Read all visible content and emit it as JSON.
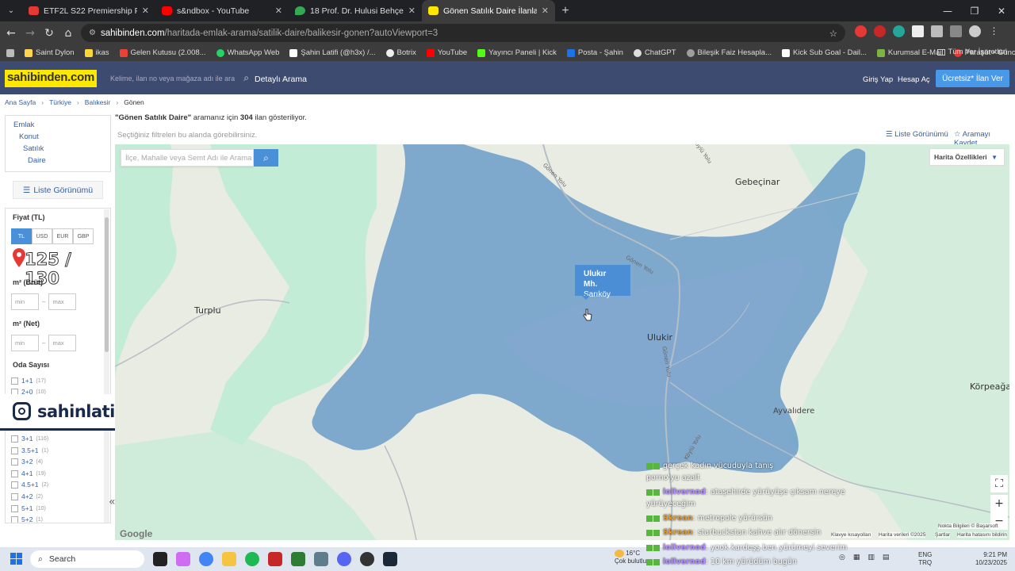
{
  "browser": {
    "tabs": [
      {
        "title": "ETF2L S22 Premiership Playoffs",
        "favcolor": "#e53935",
        "active": false
      },
      {
        "title": "s&ndbox - YouTube",
        "favcolor": "#ff0000",
        "active": false
      },
      {
        "title": "18 Prof. Dr. Hulusi Behçet Cd.",
        "favcolor": "#34a853",
        "active": false
      },
      {
        "title": "Gönen Satılık Daire İlanları ve S",
        "favcolor": "#ffe800",
        "active": true
      }
    ],
    "url_domain": "sahibinden.com",
    "url_path": "/haritada-emlak-arama/satilik-daire/balikesir-gonen?autoViewport=3",
    "bookmarks": [
      "Saint Dylon",
      "ikas",
      "Gelen Kutusu (2.008...",
      "WhatsApp Web",
      "Şahin Latifi (@h3x) /...",
      "Botrix",
      "YouTube",
      "Yayıncı Paneli | Kick",
      "Posta - Şahin",
      "ChatGPT",
      "Bileşik Faiz Hesapla...",
      "Kick Sub Goal - Dail...",
      "Kurumsal E-Mail",
      "Paraşüt • Güncel D..."
    ],
    "bookmark_all": "Tüm Yer İşaretleri"
  },
  "header": {
    "logo": "sahibinden.com",
    "search_placeholder": "Kelime, ilan no veya mağaza adı ile ara",
    "detailed_search": "Detaylı Arama",
    "login": "Giriş Yap",
    "register": "Hesap Aç",
    "post_ad": "Ücretsiz* İlan Ver"
  },
  "breadcrumb": [
    "Ana Sayfa",
    "Türkiye",
    "Balıkesir",
    "Gönen"
  ],
  "result": {
    "query": "\"Gönen Satılık Daire\"",
    "mid": " aramanız için ",
    "count": "304",
    "tail": " ilan gösteriliyor."
  },
  "hint": "Seçtiğiniz filtreleri bu alanda görebilirsiniz.",
  "list_view_link": "Liste Görünümü",
  "save_search": "Aramayı Kaydet",
  "category_nav": [
    "Emlak",
    "Konut",
    "Satılık",
    "Daire"
  ],
  "list_view_button": "Liste Görünümü",
  "filters": {
    "price_label": "Fiyat (TL)",
    "currencies": [
      "TL",
      "USD",
      "EUR",
      "GBP"
    ],
    "overlay_text": "125 / 130",
    "m2_gross_label": "m² (Brüt)",
    "m2_net_label": "m² (Net)",
    "min_placeholder": "min",
    "max_placeholder": "max",
    "rooms_label": "Oda Sayısı",
    "rooms": [
      {
        "label": "1+1",
        "count": "(17)"
      },
      {
        "label": "2+0",
        "count": "(10)"
      },
      {
        "label": "3+1",
        "count": "(116)"
      },
      {
        "label": "3.5+1",
        "count": "(1)"
      },
      {
        "label": "3+2",
        "count": "(4)"
      },
      {
        "label": "4+1",
        "count": "(19)"
      },
      {
        "label": "4.5+1",
        "count": "(2)"
      },
      {
        "label": "4+2",
        "count": "(2)"
      },
      {
        "label": "5+1",
        "count": "(10)"
      },
      {
        "label": "5+2",
        "count": "(1)"
      }
    ]
  },
  "instagram_badge": "sahinlatifi",
  "map": {
    "search_placeholder": "İlçe, Mahalle veya Semt  Adı ile Arama",
    "features": "Harita Özellikleri",
    "places": {
      "gebecinar": "Gebeçinar",
      "turplu": "Turplu",
      "ulukir": "Ulukir",
      "korpeagac": "Körpeağaç",
      "ayvalidere": "Ayvalıdere"
    },
    "roads": [
      "Gönen Yolu",
      "Gönen Yolu",
      "Gönen Yolu",
      "Köylü Yolu",
      "Köylü Yolu"
    ],
    "tooltip_title": "Ulukır Mh.",
    "tooltip_sub": "Sarıköy",
    "google": "Google",
    "attrib": [
      "Klavye kısayolları",
      "Harita verileri ©2025",
      "Şartlar",
      "Harita hatasını bildirin"
    ],
    "nokta": "Nokta Bilgileri © Başarsoft",
    "colors": {
      "polygon": "#6b9dc8",
      "land": "#e9ece3",
      "green": "#c3ecd6"
    }
  },
  "chat": [
    {
      "user": "",
      "text": "gerçek kadın vücuduyla tanış"
    },
    {
      "user": "",
      "text": "porno'yu azalt"
    },
    {
      "user": "lollvernod",
      "text": ": ataşehirde yürüyüşe çıksam nereye"
    },
    {
      "user": "",
      "text": "yürüyeceğim"
    },
    {
      "user": "Skrean",
      "text": ": metropole yürürsün"
    },
    {
      "user": "Skrean",
      "text": ": starbuckstan kahve alır dönersin"
    },
    {
      "user": "lollvernod",
      "text": ": yook kardeşş ben yürümeyi severim"
    },
    {
      "user": "lollvernod",
      "text": ": 10 km yürüdüm bugün"
    }
  ],
  "taskbar": {
    "search": "Search",
    "weather_temp": "16°C",
    "weather_desc": "Çok bulutlu",
    "lang": "ENG",
    "lang2": "TRQ",
    "time": "9:21 PM",
    "date": "10/23/2025"
  }
}
